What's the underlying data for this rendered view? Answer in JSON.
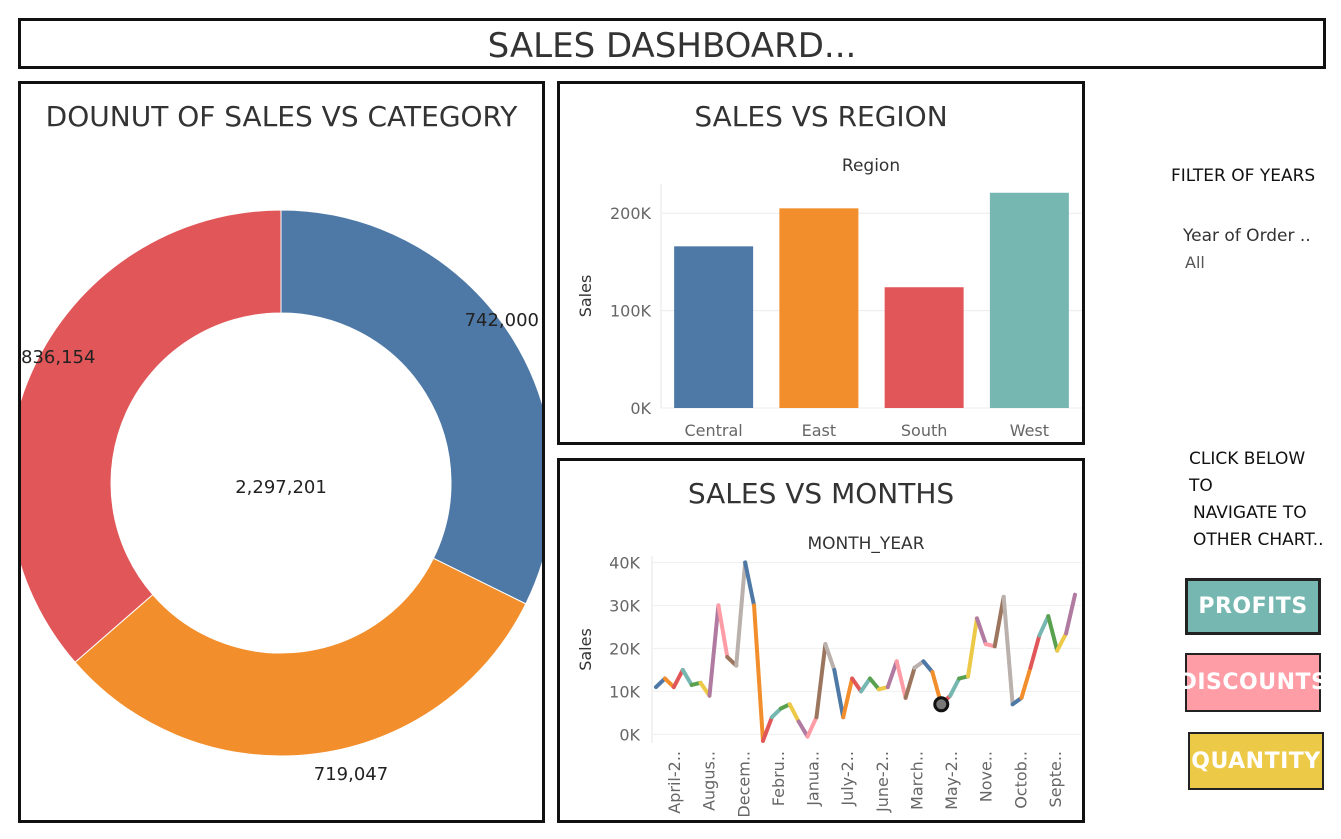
{
  "header": {
    "title": "SALES DASHBOARD..."
  },
  "donut": {
    "title": "DOUNUT OF SALES VS CATEGORY",
    "total_label": "2,297,201"
  },
  "region": {
    "title": "SALES VS REGION",
    "subtitle": "Region"
  },
  "months": {
    "title": "SALES VS MONTHS",
    "subtitle": "MONTH_YEAR"
  },
  "filter": {
    "heading": "FILTER OF YEARS",
    "field_label": "Year of Order ..",
    "field_value": "All"
  },
  "navigate": {
    "line1": "CLICK BELOW",
    "line2": "TO",
    "line3": "NAVIGATE TO",
    "line4": "OTHER CHART..",
    "buttons": [
      {
        "label": "PROFITS",
        "color": "#76b7b2"
      },
      {
        "label": "DISCOUNTS",
        "color": "#ff9da7"
      },
      {
        "label": "QUANTITY",
        "color": "#edc948"
      }
    ]
  },
  "chart_data": [
    {
      "type": "pie",
      "title": "DOUNUT OF SALES VS CATEGORY",
      "center_label": "2,297,201",
      "slices": [
        {
          "value": 742000,
          "label": "742,000",
          "color": "#4e79a7"
        },
        {
          "value": 719047,
          "label": "719,047",
          "color": "#f28e2b"
        },
        {
          "value": 836154,
          "label": "836,154",
          "color": "#e15759"
        }
      ]
    },
    {
      "type": "bar",
      "title": "SALES VS REGION",
      "subtitle": "Region",
      "categories": [
        "Central",
        "East",
        "South",
        "West"
      ],
      "values": [
        166000,
        205000,
        124000,
        221000
      ],
      "colors": [
        "#4e79a7",
        "#f28e2b",
        "#e15759",
        "#76b7b2"
      ],
      "ylabel": "Sales",
      "ylim": [
        0,
        230000
      ],
      "yticks": [
        0,
        100000,
        200000
      ],
      "ytick_labels": [
        "0K",
        "100K",
        "200K"
      ],
      "grid": true
    },
    {
      "type": "line",
      "title": "SALES VS MONTHS",
      "subtitle": "MONTH_YEAR",
      "ylabel": "Sales",
      "values": [
        11000,
        13000,
        11000,
        15000,
        11500,
        12000,
        9000,
        30000,
        18000,
        16000,
        40000,
        30000,
        -1500,
        4000,
        6000,
        7000,
        3000,
        -500,
        4000,
        21000,
        15000,
        4000,
        13000,
        10000,
        13000,
        10500,
        11000,
        17000,
        8500,
        15500,
        17000,
        14500,
        7000,
        9000,
        13000,
        13500,
        27000,
        21000,
        20500,
        32000,
        7000,
        8500,
        15500,
        23000,
        27500,
        19500,
        23500,
        32500
      ],
      "x_tick_labels": [
        "April-2..",
        "Augus..",
        "Decem..",
        "Febru..",
        "Janua..",
        "July-2..",
        "June-2..",
        "March..",
        "May-2..",
        "Nove..",
        "Octob..",
        "Septe.."
      ],
      "yticks": [
        0,
        10000,
        20000,
        30000,
        40000
      ],
      "ytick_labels": [
        "0K",
        "10K",
        "20K",
        "30K",
        "40K"
      ],
      "ylim": [
        -2000,
        41500
      ],
      "highlight_index": 32,
      "grid": true
    }
  ]
}
